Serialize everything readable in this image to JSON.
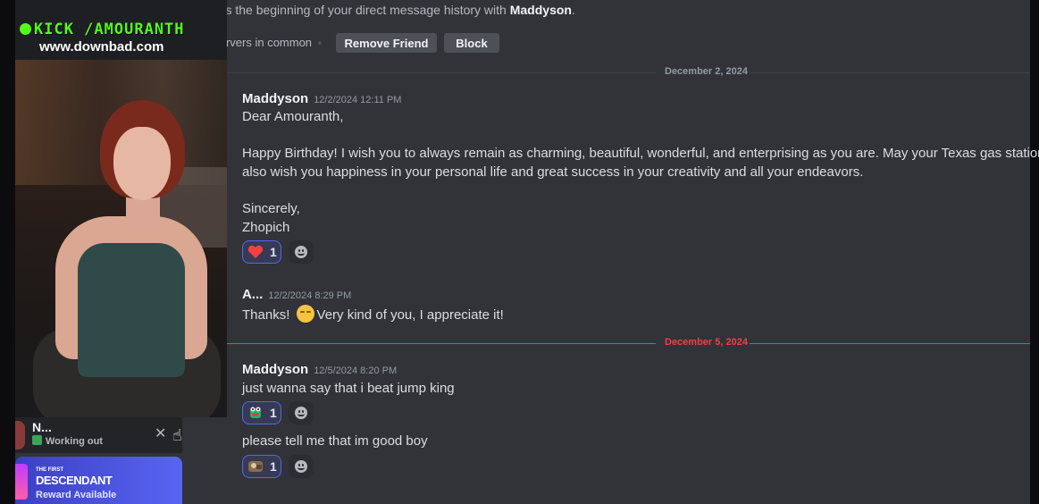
{
  "header": {
    "intro_prefix": "This is the beginning of your direct message history with ",
    "intro_name": "Maddyson",
    "intro_suffix": ".",
    "no_servers": "No servers in common",
    "remove_friend_label": "Remove Friend",
    "block_label": "Block"
  },
  "dividers": {
    "first": "December 2, 2024",
    "new": "December 5, 2024"
  },
  "messages": [
    {
      "author": "Maddyson",
      "timestamp": "12/2/2024 12:11 PM",
      "lines": [
        "Dear Amouranth,",
        "Happy Birthday! I wish you to always remain as charming, beautiful, wonderful, and enterprising as you are. May your Texas gas stations thrive",
        "also wish you happiness in your personal life and great success in your creativity and all your endeavors.",
        "Sincerely,",
        "Zhopich"
      ],
      "reaction": {
        "emoji": "heart-emoji",
        "count": "1"
      }
    },
    {
      "author": "A...",
      "timestamp": "12/2/2024 8:29 PM",
      "text_before": "Thanks!",
      "text_after": "Very kind of you, I appreciate it!"
    },
    {
      "author": "Maddyson",
      "timestamp": "12/5/2024 8:20 PM",
      "text": "just wanna say that i beat jump king",
      "reaction": {
        "emoji": "frog-emoji",
        "count": "1"
      }
    },
    {
      "text": "please tell me that im good boy",
      "reaction": {
        "emoji": "custom-emoji",
        "count": "1"
      }
    }
  ],
  "overlay": {
    "channel": "KICK /AMOURANTH",
    "site": "www.downbad.com"
  },
  "user_panel": {
    "name": "N...",
    "status": "Working out"
  },
  "promo": {
    "small": "THE FIRST",
    "title": "DESCENDANT",
    "subtitle": "Reward Available"
  },
  "colors": {
    "background": "#313338",
    "accent": "#5865f2",
    "new_divider": "#f23f43",
    "kick_green": "#53fc18"
  }
}
